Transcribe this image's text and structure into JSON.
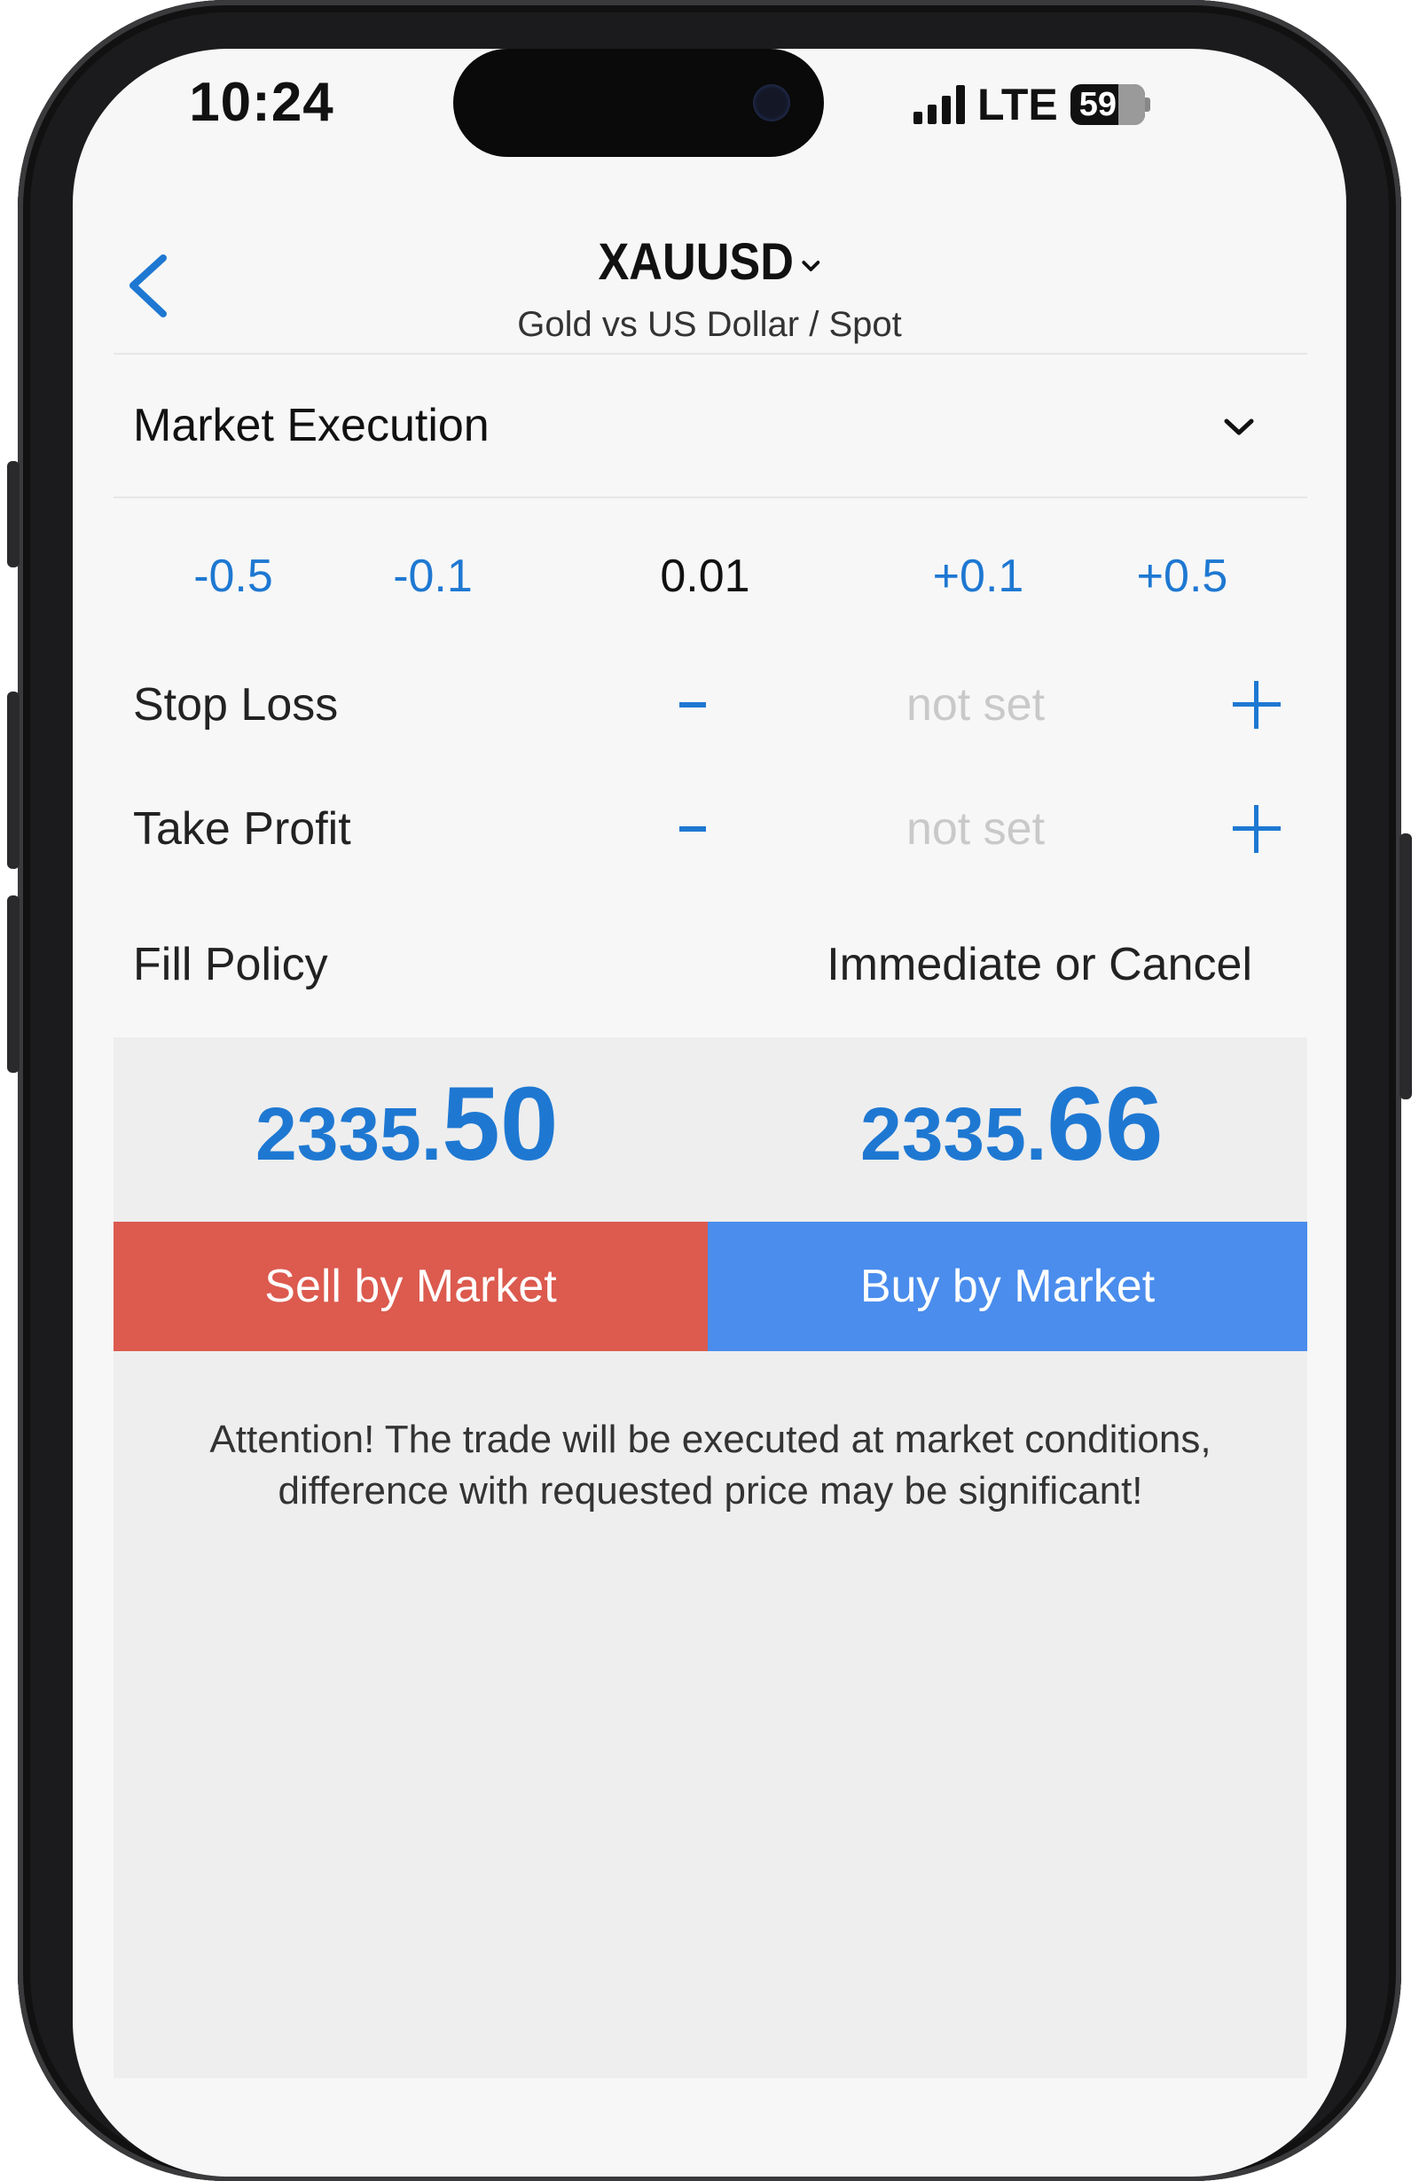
{
  "status": {
    "time": "10:24",
    "network": "LTE",
    "battery": "59"
  },
  "header": {
    "symbol": "XAUUSD",
    "description": "Gold vs US Dollar / Spot"
  },
  "order": {
    "execution_type": "Market Execution",
    "volume_steps": [
      "-0.5",
      "-0.1",
      "0.01",
      "+0.1",
      "+0.5"
    ],
    "stop_loss": {
      "label": "Stop Loss",
      "value": "not set"
    },
    "take_profit": {
      "label": "Take Profit",
      "value": "not set"
    },
    "fill_policy": {
      "label": "Fill Policy",
      "value": "Immediate or Cancel"
    }
  },
  "quotes": {
    "bid_main": "2335.",
    "bid_pips": "50",
    "ask_main": "2335.",
    "ask_pips": "66"
  },
  "actions": {
    "sell_label": "Sell by Market",
    "buy_label": "Buy by Market"
  },
  "attention": {
    "line1": "Attention! The trade will be executed at market conditions,",
    "line2": "difference with requested price may be significant!"
  },
  "colors": {
    "accent_blue": "#1e78d2",
    "sell": "#dc5a4e",
    "buy": "#4a8ded"
  }
}
